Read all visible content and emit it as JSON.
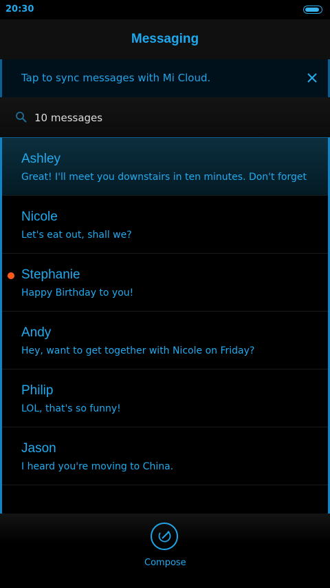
{
  "status": {
    "time": "20:30",
    "battery_level": 1.0
  },
  "header": {
    "title": "Messaging"
  },
  "sync_banner": {
    "text": "Tap to sync messages with Mi Cloud.",
    "close_icon": "close-icon"
  },
  "search": {
    "text": "10 messages",
    "icon": "search-icon"
  },
  "conversations": [
    {
      "name": "Ashley",
      "snippet": "Great! I'll meet you downstairs in ten minutes. Don't forget",
      "selected": true,
      "unread": false
    },
    {
      "name": "Nicole",
      "snippet": "Let's eat out, shall we?",
      "selected": false,
      "unread": false
    },
    {
      "name": "Stephanie",
      "snippet": "Happy Birthday to you!",
      "selected": false,
      "unread": true
    },
    {
      "name": "Andy",
      "snippet": "Hey, want to get together with Nicole on Friday?",
      "selected": false,
      "unread": false
    },
    {
      "name": "Philip",
      "snippet": "LOL, that's so funny!",
      "selected": false,
      "unread": false
    },
    {
      "name": "Jason",
      "snippet": "I heard you're moving to China.",
      "selected": false,
      "unread": false
    }
  ],
  "bottom": {
    "compose_label": "Compose",
    "compose_icon": "compose-icon"
  },
  "colors": {
    "accent": "#22aaee",
    "unread": "#ff5a1a",
    "background": "#000000"
  }
}
